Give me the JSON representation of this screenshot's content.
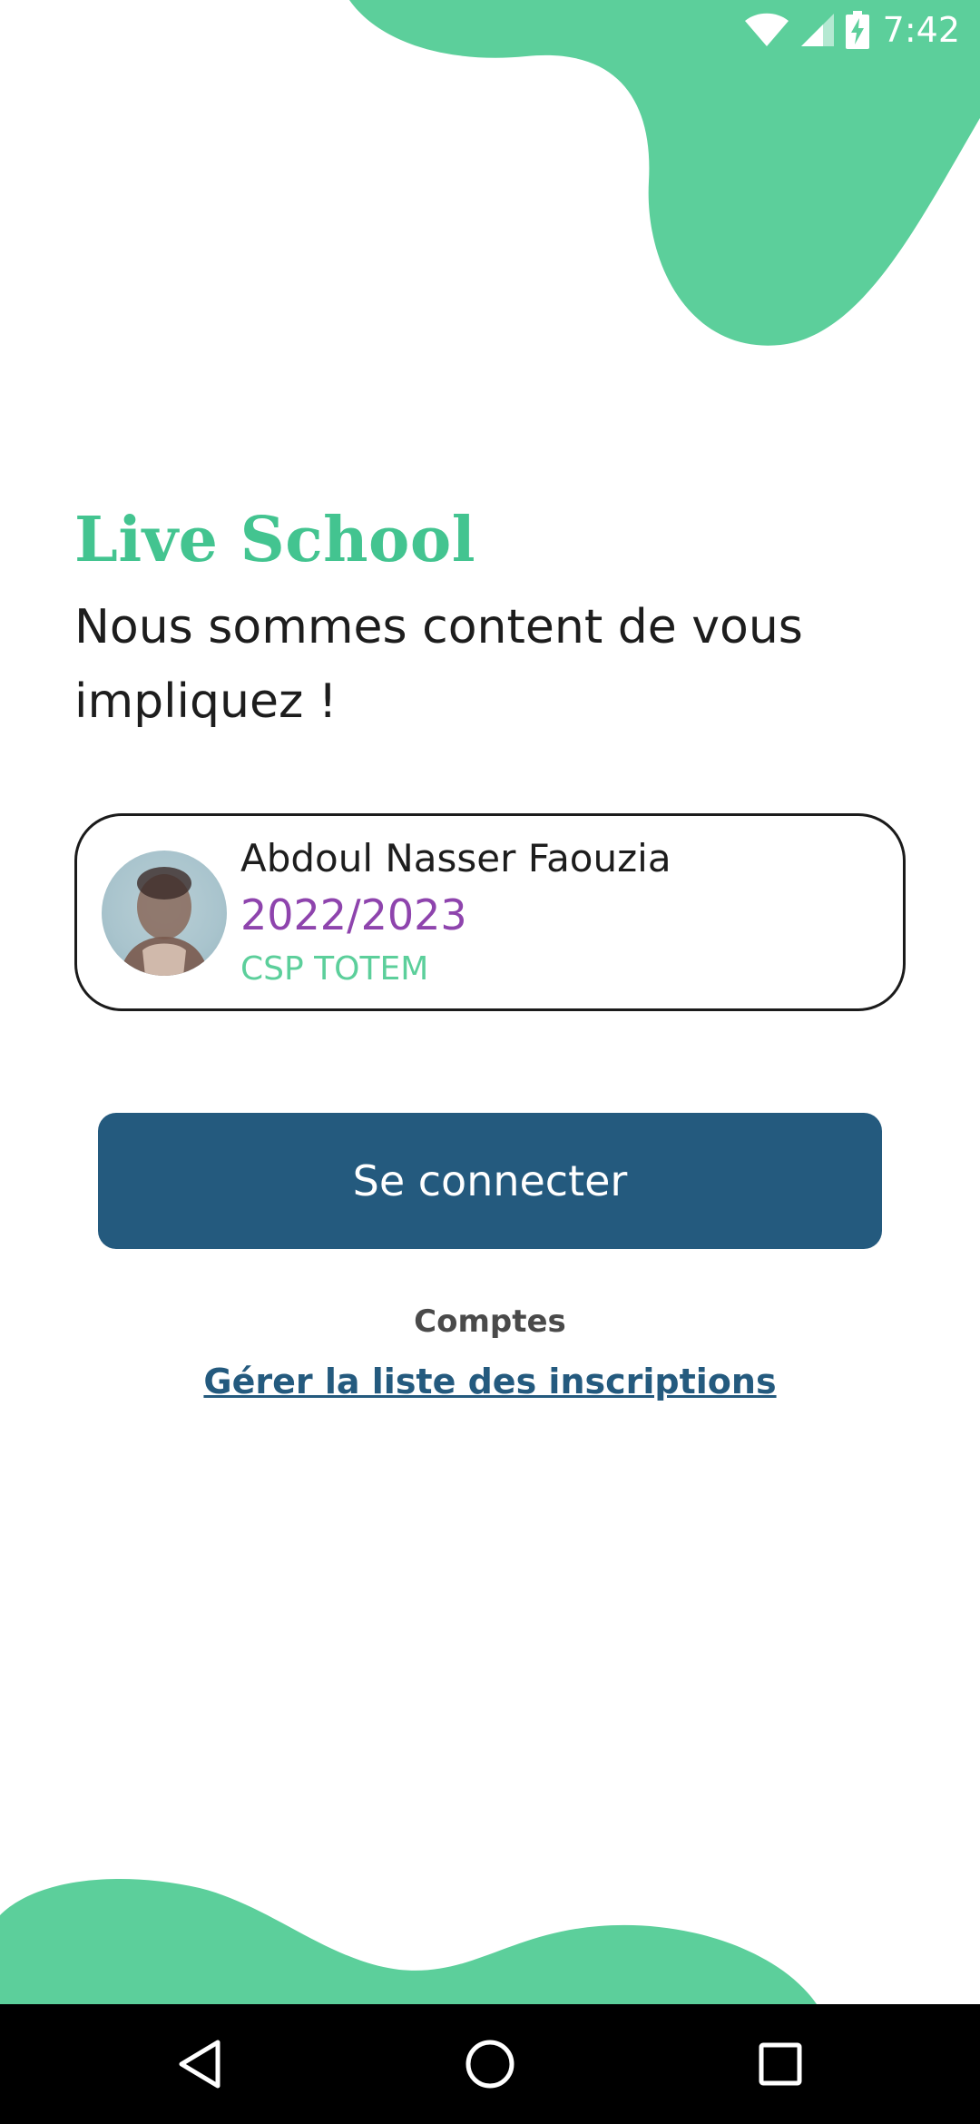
{
  "status_bar": {
    "time": "7:42",
    "icons": [
      "wifi-icon",
      "cell-signal-icon",
      "battery-charging-icon"
    ]
  },
  "app": {
    "title": "Live School",
    "welcome": "Nous sommes content de vous impliquez !"
  },
  "account": {
    "name": "Abdoul Nasser Faouzia",
    "year": "2022/2023",
    "school": "CSP TOTEM"
  },
  "actions": {
    "login_label": "Se connecter",
    "accounts_label": "Comptes",
    "manage_link": "Gérer la liste des inscriptions"
  },
  "nav": {
    "icons": [
      "back-icon",
      "home-icon",
      "recents-icon"
    ]
  },
  "colors": {
    "accent_green": "#5ccf9b",
    "title_green": "#43c490",
    "primary_blue": "#245a7e",
    "year_purple": "#8e44ad"
  }
}
